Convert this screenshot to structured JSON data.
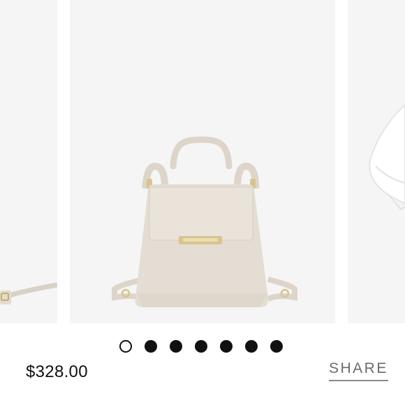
{
  "gallery": {
    "slides": [
      {
        "name": "product-image-previous",
        "icon": "handbag-strap-partial"
      },
      {
        "name": "product-image-current",
        "icon": "beige-mini-backpack"
      },
      {
        "name": "product-image-next",
        "icon": "model-white-shirt-partial"
      }
    ],
    "dots": [
      {
        "active": true
      },
      {
        "active": false
      },
      {
        "active": false
      },
      {
        "active": false
      },
      {
        "active": false
      },
      {
        "active": false
      },
      {
        "active": false
      }
    ]
  },
  "product": {
    "price": "$328.00"
  },
  "actions": {
    "share_label": "SHARE"
  },
  "colors": {
    "panel_bg": "#f5f5f5",
    "bag_body": "#e4ddd3",
    "hardware_gold": "#d9c48e",
    "text": "#111111",
    "share_text": "#6b6b6b"
  }
}
